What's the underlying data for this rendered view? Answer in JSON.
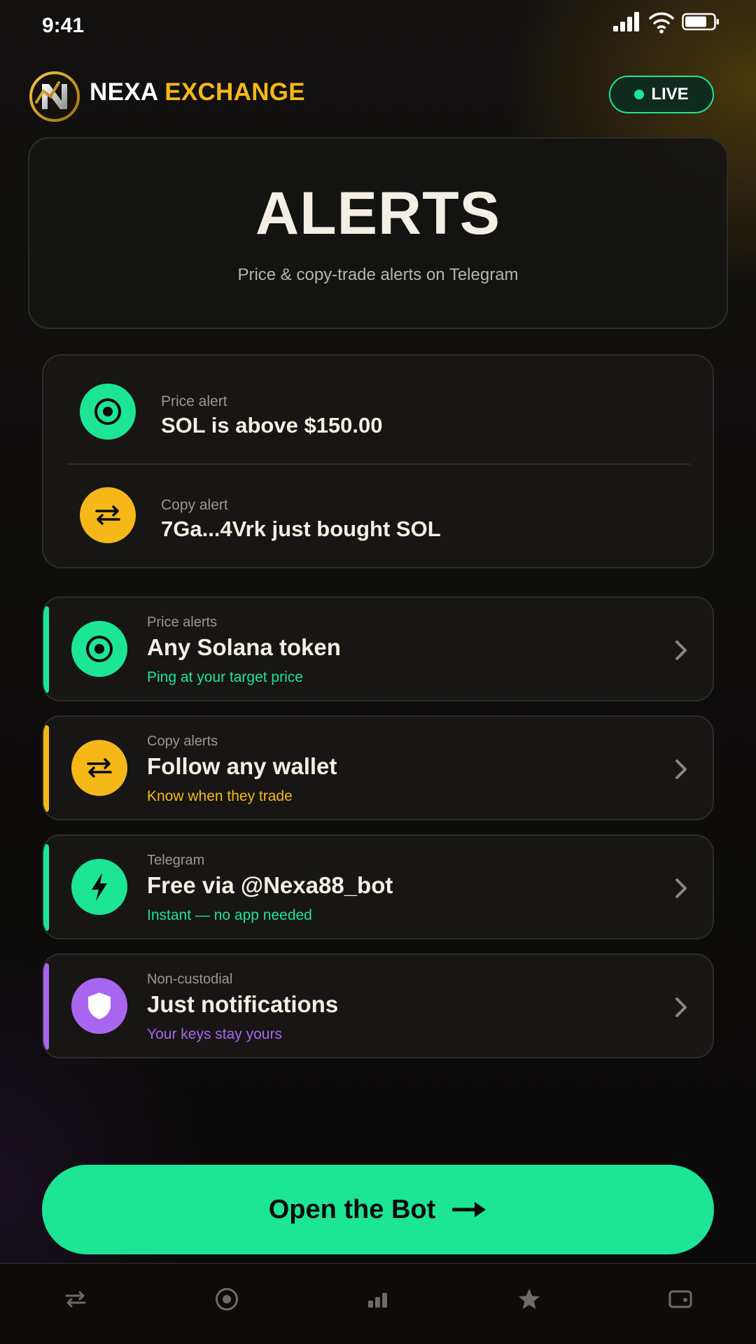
{
  "status_bar": {
    "time": "9:41"
  },
  "header": {
    "brand_part1": "NEXA",
    "brand_part2": "EXCHANGE",
    "live_label": "LIVE"
  },
  "hero": {
    "title": "ALERTS",
    "subtitle": "Price & copy-trade alerts on Telegram"
  },
  "preview": [
    {
      "icon": "target-icon",
      "label": "Price alert",
      "text": "SOL is above $150.00",
      "color": "#1de596"
    },
    {
      "icon": "swap-arrows-icon",
      "label": "Copy alert",
      "text": "7Ga...4Vrk just bought SOL",
      "color": "#f5b818"
    }
  ],
  "features": [
    {
      "icon": "target-icon",
      "label": "Price alerts",
      "title": "Any Solana token",
      "subtitle": "Ping at your target price",
      "color": "#1de596"
    },
    {
      "icon": "swap-arrows-icon",
      "label": "Copy alerts",
      "title": "Follow any wallet",
      "subtitle": "Know when they trade",
      "color": "#f5b818"
    },
    {
      "icon": "lightning-icon",
      "label": "Telegram",
      "title": "Free via @Nexa88_bot",
      "subtitle": "Instant — no app needed",
      "color": "#1de596"
    },
    {
      "icon": "shield-icon",
      "label": "Non-custodial",
      "title": "Just notifications",
      "subtitle": "Your keys stay yours",
      "color": "#a866f0"
    }
  ],
  "cta": {
    "label": "Open the Bot"
  },
  "bottom_nav": [
    {
      "icon": "swap-arrows-icon"
    },
    {
      "icon": "target-icon"
    },
    {
      "icon": "bar-chart-icon"
    },
    {
      "icon": "star-icon"
    },
    {
      "icon": "wallet-icon"
    }
  ],
  "colors": {
    "accent_green": "#1de596",
    "accent_gold": "#f5b818",
    "accent_purple": "#a866f0",
    "background": "#0d0c0b"
  }
}
